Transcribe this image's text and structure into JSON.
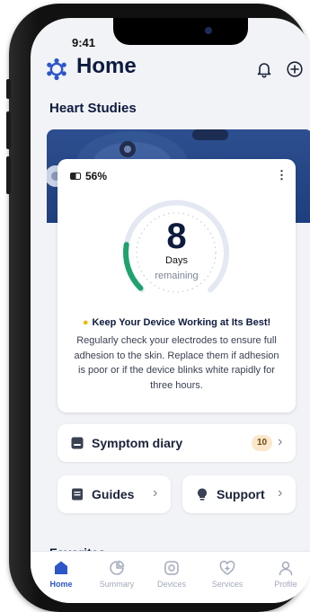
{
  "status_bar": {
    "time": "9:41"
  },
  "header": {
    "title": "Home",
    "bell_icon": "bell-icon",
    "add_icon": "plus-circle-icon"
  },
  "heart_studies": {
    "section_title": "Heart Studies"
  },
  "device": {
    "battery_percent": "56%",
    "battery_level": 0.56,
    "days_number": "8",
    "days_label": "Days",
    "days_sublabel": "remaining",
    "remaining_fraction": 0.2,
    "tip_title": "Keep Your Device Working at Its Best!",
    "tip_body": "Regularly check your electrodes to ensure full adhesion to the skin. Replace them if adhesion is poor or if the device blinks white rapidly for three hours."
  },
  "actions": {
    "symptom_diary": {
      "label": "Symptom diary",
      "count": "10"
    },
    "guides": {
      "label": "Guides"
    },
    "support": {
      "label": "Support"
    }
  },
  "favorites": {
    "title": "Favorites"
  },
  "tabs": [
    {
      "label": "Home",
      "icon": "home-icon",
      "active": true
    },
    {
      "label": "Summary",
      "icon": "summary-icon",
      "active": false
    },
    {
      "label": "Devices",
      "icon": "device-icon",
      "active": false
    },
    {
      "label": "Services",
      "icon": "services-icon",
      "active": false
    },
    {
      "label": "Profile",
      "icon": "profile-icon",
      "active": false
    }
  ],
  "colors": {
    "navy": "#0d1b3e",
    "accent_blue": "#2d56c8",
    "gauge_green": "#1fa36e",
    "banner_blue": "#1e3f7e",
    "badge_bg": "#fbe7cc"
  }
}
